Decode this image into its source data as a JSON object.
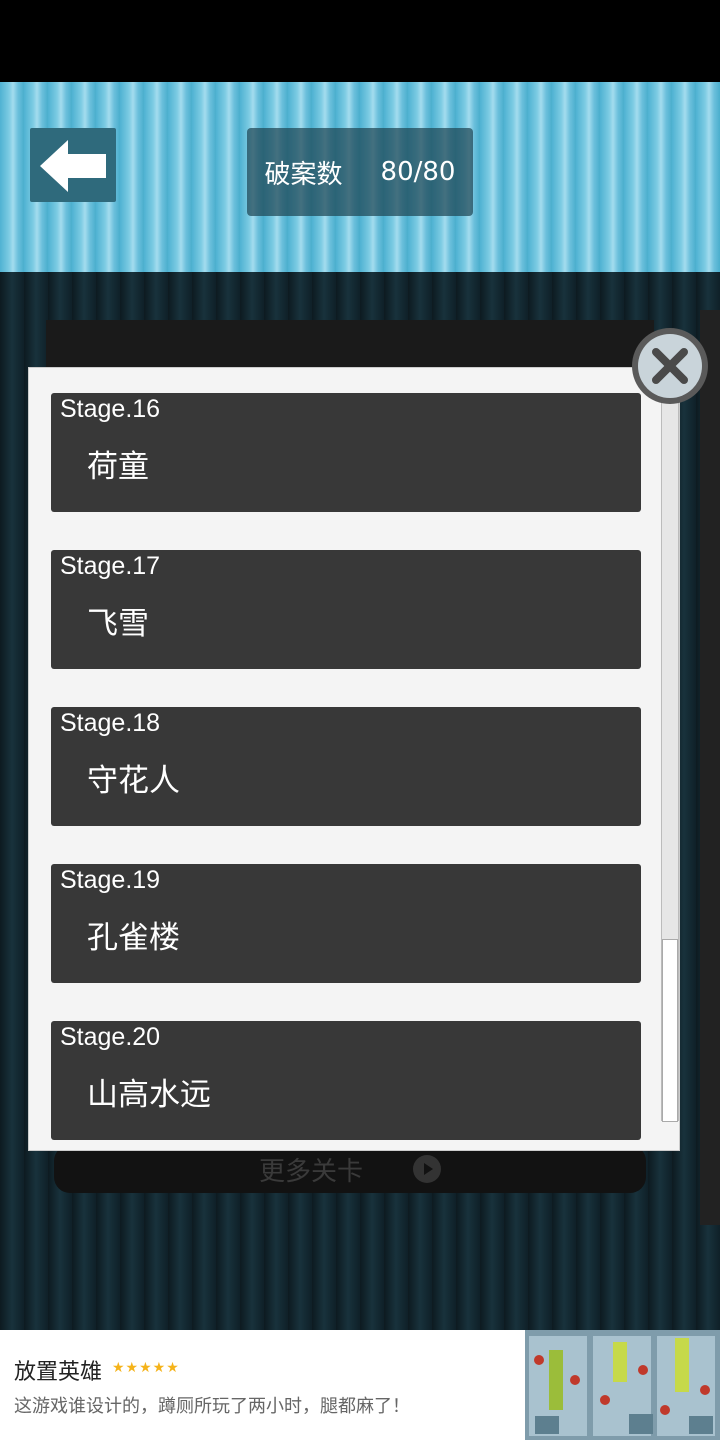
{
  "header": {
    "counter_label": "破案数",
    "counter_value": "80/80"
  },
  "more_levels": {
    "label": "更多关卡"
  },
  "stages": [
    {
      "num": "Stage.16",
      "name": "荷童"
    },
    {
      "num": "Stage.17",
      "name": "飞雪"
    },
    {
      "num": "Stage.18",
      "name": "守花人"
    },
    {
      "num": "Stage.19",
      "name": "孔雀楼"
    },
    {
      "num": "Stage.20",
      "name": "山高水远"
    }
  ],
  "ad": {
    "title": "放置英雄",
    "stars": "★★★★★",
    "description": "这游戏谁设计的，蹲厕所玩了两小时，腿都麻了！",
    "close_symbol": "✕"
  },
  "colors": {
    "header_accent": "#4fb2d2",
    "stage_card": "#383838",
    "dialog_bg": "#f4f4f4",
    "star": "#f5b31a"
  },
  "icons": {
    "back": "back-arrow-icon",
    "close": "close-icon",
    "play": "play-icon"
  }
}
